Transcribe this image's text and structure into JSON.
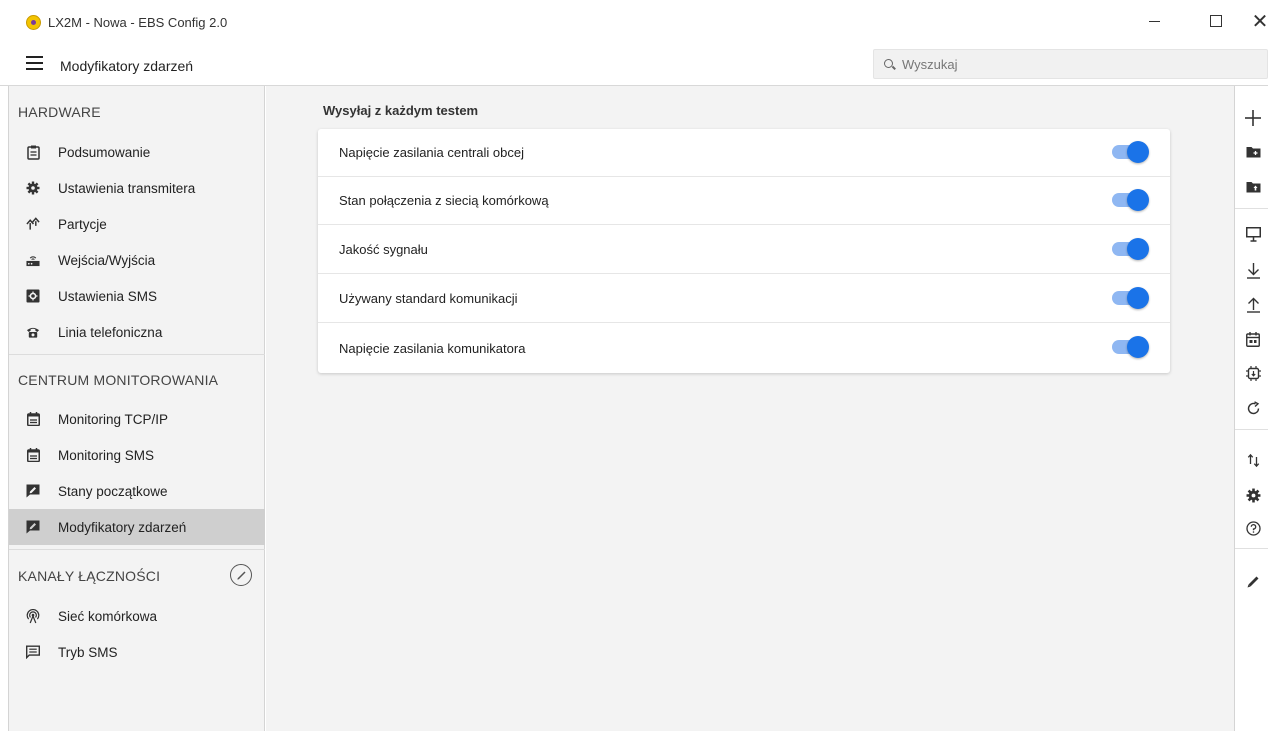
{
  "window": {
    "title": "LX2M - Nowa - EBS Config 2.0",
    "controls": [
      "minimize",
      "maximize",
      "close"
    ]
  },
  "header": {
    "page_title": "Modyfikatory zdarzeń",
    "search_placeholder": "Wyszukaj"
  },
  "sidebar": {
    "sections": [
      {
        "title": "HARDWARE",
        "items": [
          {
            "label": "Podsumowanie",
            "icon": "clipboard-icon"
          },
          {
            "label": "Ustawienia transmitera",
            "icon": "gear-icon"
          },
          {
            "label": "Partycje",
            "icon": "partition-icon"
          },
          {
            "label": "Wejścia/Wyjścia",
            "icon": "io-icon"
          },
          {
            "label": "Ustawienia SMS",
            "icon": "sms-settings-icon"
          },
          {
            "label": "Linia telefoniczna",
            "icon": "phone-icon"
          }
        ]
      },
      {
        "title": "CENTRUM MONITOROWANIA",
        "items": [
          {
            "label": "Monitoring TCP/IP",
            "icon": "calendar-icon"
          },
          {
            "label": "Monitoring SMS",
            "icon": "calendar-icon"
          },
          {
            "label": "Stany początkowe",
            "icon": "comment-edit-icon"
          },
          {
            "label": "Modyfikatory zdarzeń",
            "icon": "comment-edit-icon",
            "active": true
          }
        ]
      },
      {
        "title": "KANAŁY ŁĄCZNOŚCI",
        "items": [
          {
            "label": "Sieć komórkowa",
            "icon": "antenna-icon"
          },
          {
            "label": "Tryb SMS",
            "icon": "message-icon"
          }
        ]
      }
    ]
  },
  "main": {
    "heading": "Wysyłaj z każdym testem",
    "rows": [
      {
        "label": "Napięcie zasilania centrali obcej",
        "enabled": true
      },
      {
        "label": "Stan połączenia z siecią komórkową",
        "enabled": true
      },
      {
        "label": "Jakość sygnału",
        "enabled": true
      },
      {
        "label": "Używany standard komunikacji",
        "enabled": true
      },
      {
        "label": "Napięcie zasilania komunikatora",
        "enabled": true
      }
    ]
  },
  "toolbar": {
    "icons": [
      "plus-icon",
      "folder-add-icon",
      "folder-upload-icon",
      "monitor-icon",
      "download-icon",
      "upload-icon",
      "calendar-icon",
      "chip-icon",
      "refresh-icon",
      "sort-icon",
      "gear-icon",
      "help-icon",
      "pencil-icon"
    ]
  },
  "colors": {
    "accent": "#1a73e8",
    "toggle_track": "#8fb7f2",
    "sidebar_bg": "#f3f3f3",
    "active_item_bg": "#cfcfcf"
  }
}
